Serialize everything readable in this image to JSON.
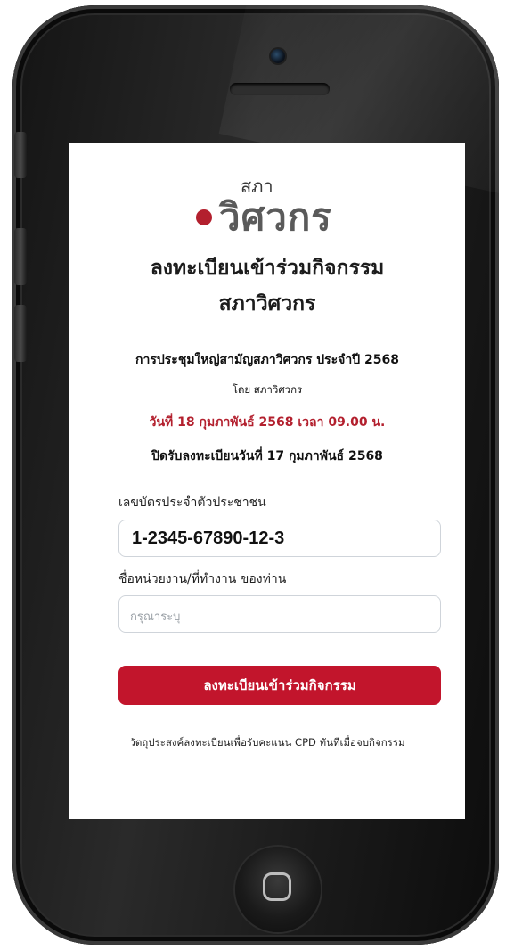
{
  "logo": {
    "small_text": "สภา",
    "big_text": "วิศวกร"
  },
  "header": {
    "title_line1": "ลงทะเบียนเข้าร่วมกิจกรรม",
    "title_line2": "สภาวิศวกร"
  },
  "event": {
    "name": "การประชุมใหญ่สามัญสภาวิศวกร ประจำปี 2568",
    "organizer": "โดย สภาวิศวกร",
    "datetime": "วันที่ 18 กุมภาพันธ์ 2568 เวลา 09.00 น.",
    "deadline": "ปิดรับลงทะเบียนวันที่ 17 กุมภาพันธ์ 2568"
  },
  "form": {
    "id_label": "เลขบัตรประจำตัวประชาชน",
    "id_value": "1-2345-67890-12-3",
    "org_label": "ชื่อหน่วยงาน/ที่ทำงาน ของท่าน",
    "org_placeholder": "กรุณาระบุ",
    "submit_label": "ลงทะเบียนเข้าร่วมกิจกรรม"
  },
  "footer": {
    "note": "วัตถุประสงค์ลงทะเบียนเพื่อรับคะแนน CPD ทันทีเมื่อจบกิจกรรม"
  },
  "colors": {
    "accent_red": "#c2152c",
    "logo_dot": "#b3202e"
  }
}
